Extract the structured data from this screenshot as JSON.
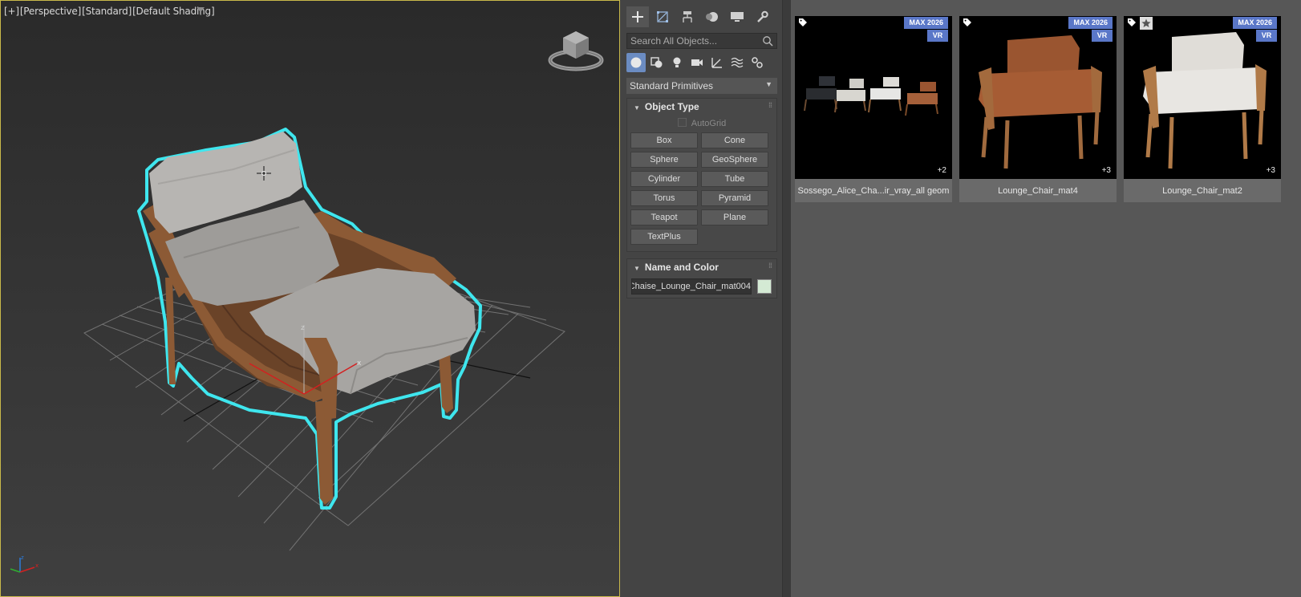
{
  "viewport": {
    "label_parts": [
      "[+]",
      "[Perspective]",
      "[Standard]",
      "[Default Shading]"
    ],
    "gizmo_labels": {
      "x": "x",
      "z": "z"
    },
    "filter_icon": "funnel-icon"
  },
  "command_panel": {
    "tabs": [
      {
        "name": "create",
        "icon": "plus-icon"
      },
      {
        "name": "modify",
        "icon": "modify-icon"
      },
      {
        "name": "hierarchy",
        "icon": "hierarchy-icon"
      },
      {
        "name": "motion",
        "icon": "motion-icon"
      },
      {
        "name": "display",
        "icon": "display-icon"
      },
      {
        "name": "utilities",
        "icon": "wrench-icon"
      }
    ],
    "search_placeholder": "Search All Objects...",
    "subtabs": [
      "geometry-icon",
      "shapes-icon",
      "lights-icon",
      "cameras-icon",
      "helpers-icon",
      "spacewarps-icon",
      "systems-icon"
    ],
    "category": "Standard Primitives",
    "object_type": {
      "title": "Object Type",
      "autogrid": "AutoGrid",
      "buttons": [
        "Box",
        "Cone",
        "Sphere",
        "GeoSphere",
        "Cylinder",
        "Tube",
        "Torus",
        "Pyramid",
        "Teapot",
        "Plane",
        "TextPlus"
      ]
    },
    "name_color": {
      "title": "Name and Color",
      "name": "Chaise_Lounge_Chair_mat004",
      "color": "#d4ead4"
    }
  },
  "library": {
    "cards": [
      {
        "caption": "Sossego_Alice_Cha...ir_vray_all geom",
        "version": "MAX 2026",
        "renderer": "VR",
        "extra": "+2",
        "starred": false
      },
      {
        "caption": "Lounge_Chair_mat4",
        "version": "MAX 2026",
        "renderer": "VR",
        "extra": "+3",
        "starred": false
      },
      {
        "caption": "Lounge_Chair_mat2",
        "version": "MAX 2026",
        "renderer": "VR",
        "extra": "+3",
        "starred": true
      }
    ]
  },
  "colors": {
    "selection_outline": "#3fe6ee",
    "badge": "#5a77c8",
    "active_subtab": "#6b8cc2"
  }
}
